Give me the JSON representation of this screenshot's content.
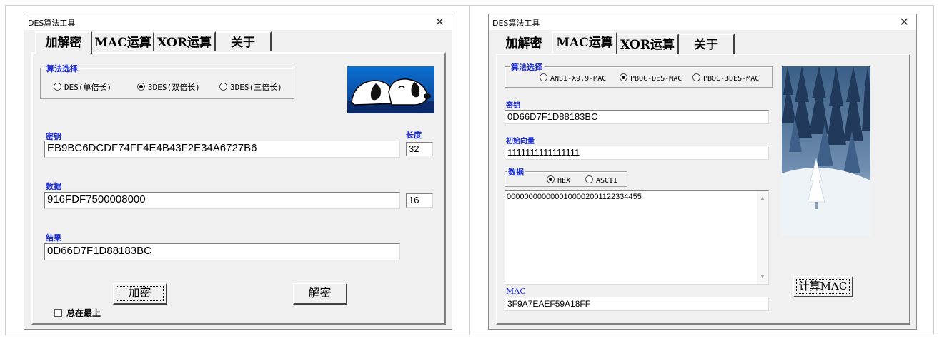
{
  "left": {
    "window_title": "DES算法工具",
    "close": "✕",
    "tabs": [
      "加解密",
      "MAC运算",
      "XOR运算",
      "关于"
    ],
    "algo_group_title": "算法选择",
    "algo_options": [
      "DES(单倍长)",
      "3DES(双倍长)",
      "3DES(三倍长)"
    ],
    "algo_selected": "3DES(双倍长)",
    "key_label": "密钥",
    "key_value": "EB9BC6DCDF74FF4E4B43F2E34A6727B6",
    "length_label": "长度",
    "key_length": "32",
    "data_label": "数据",
    "data_value": "916FDF7500008000",
    "data_length": "16",
    "result_label": "结果",
    "result_value": "0D66D7F1D88183BC",
    "encrypt_button": "加密",
    "decrypt_button": "解密",
    "always_on_top": "总在最上"
  },
  "right": {
    "window_title": "DES算法工具",
    "close": "✕",
    "tabs": [
      "加解密",
      "MAC运算",
      "XOR运算",
      "关于"
    ],
    "algo_group_title": "算法选择",
    "algo_options": [
      "ANSI-X9.9-MAC",
      "PBOC-DES-MAC",
      "PBOC-3DES-MAC"
    ],
    "algo_selected": "PBOC-DES-MAC",
    "key_label": "密钥",
    "key_value": "0D66D7F1D88183BC",
    "iv_label": "初始向量",
    "iv_value": "1111111111111111",
    "data_group_title": "数据",
    "data_format_options": [
      "HEX",
      "ASCII"
    ],
    "data_format_selected": "HEX",
    "data_value": "000000000000010000200112233445​5",
    "mac_label": "MAC",
    "mac_value": "3F9A7EAEF59A18FF",
    "calc_mac_button": "计算MAC"
  }
}
